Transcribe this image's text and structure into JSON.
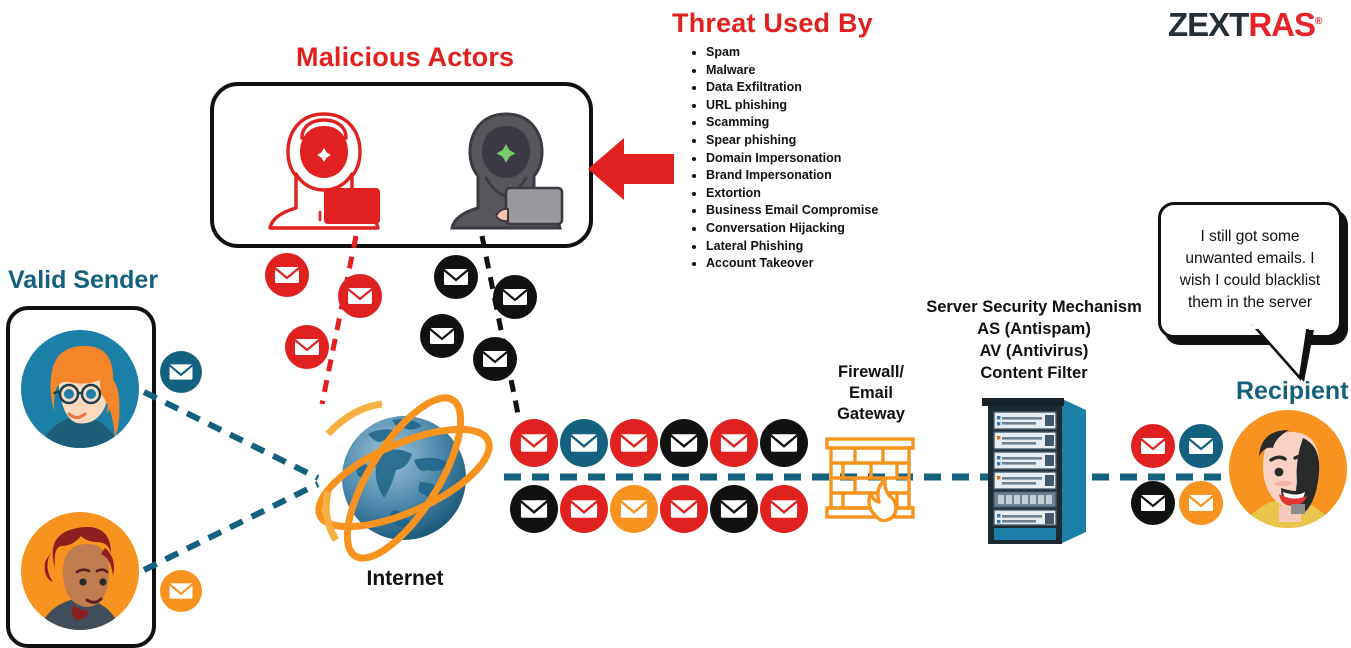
{
  "logo": {
    "part1": "ZEXT",
    "part2": "RAS",
    "trademark": "®"
  },
  "headings": {
    "threat_used_by": "Threat Used By",
    "malicious_actors": "Malicious Actors",
    "valid_sender": "Valid Sender",
    "recipient": "Recipient"
  },
  "threats": [
    "Spam",
    "Malware",
    "Data Exfiltration",
    "URL phishing",
    "Scamming",
    "Spear phishing",
    "Domain Impersonation",
    "Brand Impersonation",
    "Extortion",
    "Business Email Compromise",
    "Conversation Hijacking",
    "Lateral Phishing",
    "Account Takeover"
  ],
  "labels": {
    "firewall": "Firewall/\nEmail\nGateway",
    "server_security": "Server Security Mechanism\nAS (Antispam)\nAV (Antivirus)\nContent Filter",
    "internet": "Internet"
  },
  "speech_bubble": {
    "text": "I still got some unwanted emails.  I wish I could blacklist them in the server"
  },
  "colors": {
    "red": "#E0211F",
    "teal": "#14607F",
    "orange": "#F7941E",
    "black": "#111111",
    "logo_dark": "#262E36",
    "logo_red": "#E8232A"
  },
  "email_flow": {
    "inbound_top_row": [
      "red",
      "teal",
      "red",
      "black",
      "red",
      "black"
    ],
    "inbound_bottom_row": [
      "black",
      "red",
      "orange",
      "red",
      "black",
      "red"
    ],
    "delivered_top_row": [
      "red",
      "teal"
    ],
    "delivered_bottom_row": [
      "black",
      "orange"
    ],
    "actor_red_envelopes": 3,
    "actor_black_envelopes": 4,
    "sender_envelopes": [
      "teal",
      "orange"
    ]
  }
}
